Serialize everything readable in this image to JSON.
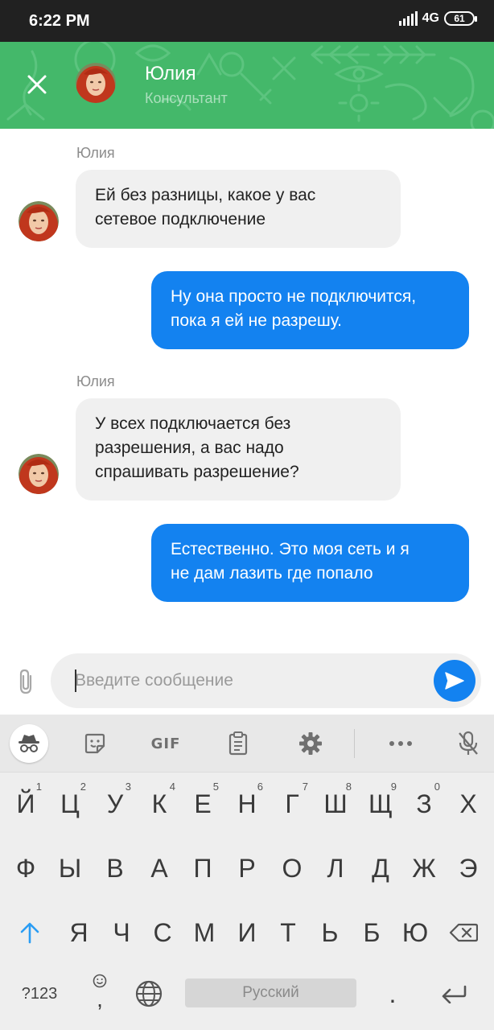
{
  "status_bar": {
    "time": "6:22 PM",
    "network": "4G",
    "battery": "61"
  },
  "header": {
    "agent_name": "Юлия",
    "agent_role": "Консультант"
  },
  "messages": [
    {
      "direction": "in",
      "sender": "Юлия",
      "lines": [
        "Ей без разницы, какое у вас",
        "сетевое подключение"
      ]
    },
    {
      "direction": "out",
      "lines": [
        "Ну она просто не подключится,",
        "пока я ей не разрешу."
      ]
    },
    {
      "direction": "in",
      "sender": "Юлия",
      "lines": [
        "У всех подключается без",
        "разрешения, а вас надо",
        "спрашивать разрешение?"
      ]
    },
    {
      "direction": "out",
      "lines": [
        "Естественно. Это моя сеть и я",
        "не дам лазить где попало"
      ]
    }
  ],
  "composer": {
    "placeholder": "Введите сообщение",
    "value": ""
  },
  "keyboard": {
    "toolbar": {
      "gif_label": "GIF"
    },
    "row1": [
      {
        "k": "Й",
        "n": "1"
      },
      {
        "k": "Ц",
        "n": "2"
      },
      {
        "k": "У",
        "n": "3"
      },
      {
        "k": "К",
        "n": "4"
      },
      {
        "k": "Е",
        "n": "5"
      },
      {
        "k": "Н",
        "n": "6"
      },
      {
        "k": "Г",
        "n": "7"
      },
      {
        "k": "Ш",
        "n": "8"
      },
      {
        "k": "Щ",
        "n": "9"
      },
      {
        "k": "З",
        "n": "0"
      },
      {
        "k": "Х",
        "n": ""
      }
    ],
    "row2": [
      "Ф",
      "Ы",
      "В",
      "А",
      "П",
      "Р",
      "О",
      "Л",
      "Д",
      "Ж",
      "Э"
    ],
    "row3": [
      "Я",
      "Ч",
      "С",
      "М",
      "И",
      "Т",
      "Ь",
      "Б",
      "Ю"
    ],
    "symbols_label": "?123",
    "comma": ",",
    "space_label": "Русский",
    "period": "."
  },
  "colors": {
    "header_green": "#44b86a",
    "accent_blue": "#1382f0",
    "incoming_bubble": "#f0f0f0"
  }
}
